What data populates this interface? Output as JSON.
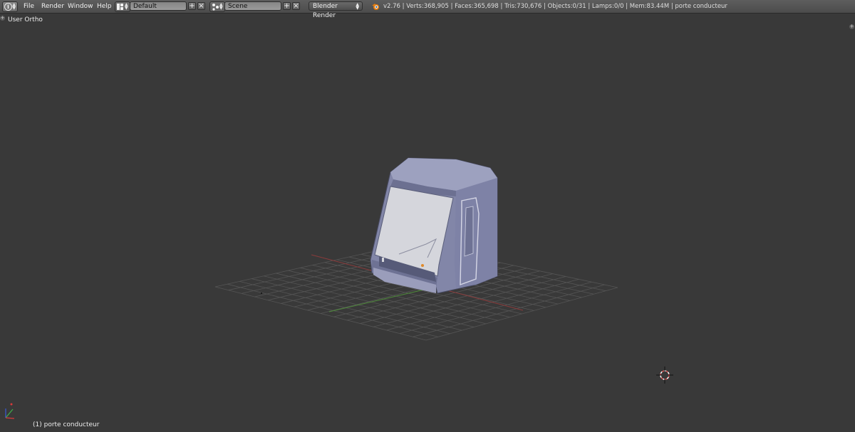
{
  "header": {
    "menus": [
      "File",
      "Render",
      "Window",
      "Help"
    ],
    "layout_name": "Default",
    "scene_name": "Scene",
    "render_engine": "Blender Render",
    "stats": "v2.76 | Verts:368,905 | Faces:365,698 | Tris:730,676 | Objects:0/31 | Lamps:0/0 | Mem:83.44M | porte conducteur",
    "add_symbol": "+",
    "remove_symbol": "×"
  },
  "viewport": {
    "view_name": "User Ortho",
    "object_label": "(1) porte conducteur"
  },
  "colors": {
    "viewport_bg": "#393939",
    "header_bg": "#545454",
    "grid": "#555555",
    "x_axis": "#8a3b3b",
    "y_axis": "#4f8a3b",
    "model_body": "#8b90b5",
    "model_glass": "#d6d7dc",
    "cursor_red": "#d85050"
  },
  "icons": {
    "editor_type": "info-icon",
    "layout": "screen-layout-icon",
    "scene": "scene-icon",
    "engine_logo": "blender-logo-icon",
    "cursor": "3d-cursor-icon",
    "axis_gizmo": "axis-gizmo-icon"
  }
}
